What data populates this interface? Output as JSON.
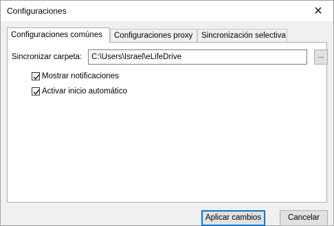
{
  "window": {
    "title": "Configuraciones",
    "close_glyph": "✕"
  },
  "tabs": [
    {
      "label": "Configuraciones comúnes",
      "active": true
    },
    {
      "label": "Configuraciones proxy",
      "active": false
    },
    {
      "label": "Sincronización selectiva",
      "active": false
    }
  ],
  "general": {
    "sync_folder_label": "Sincronizar carpeta:",
    "sync_folder_value": "C:\\Users\\Israel\\eLifeDrive",
    "browse_label": "...",
    "show_notifications_label": "Mostrar notificaciones",
    "show_notifications_checked": true,
    "autostart_label": "Activar inicio automático",
    "autostart_checked": true
  },
  "footer": {
    "apply_label": "Aplicar cambios",
    "cancel_label": "Cancelar"
  },
  "colors": {
    "accent": "#0078d7",
    "window_bg": "#f0f0f0",
    "panel_bg": "#ffffff"
  }
}
